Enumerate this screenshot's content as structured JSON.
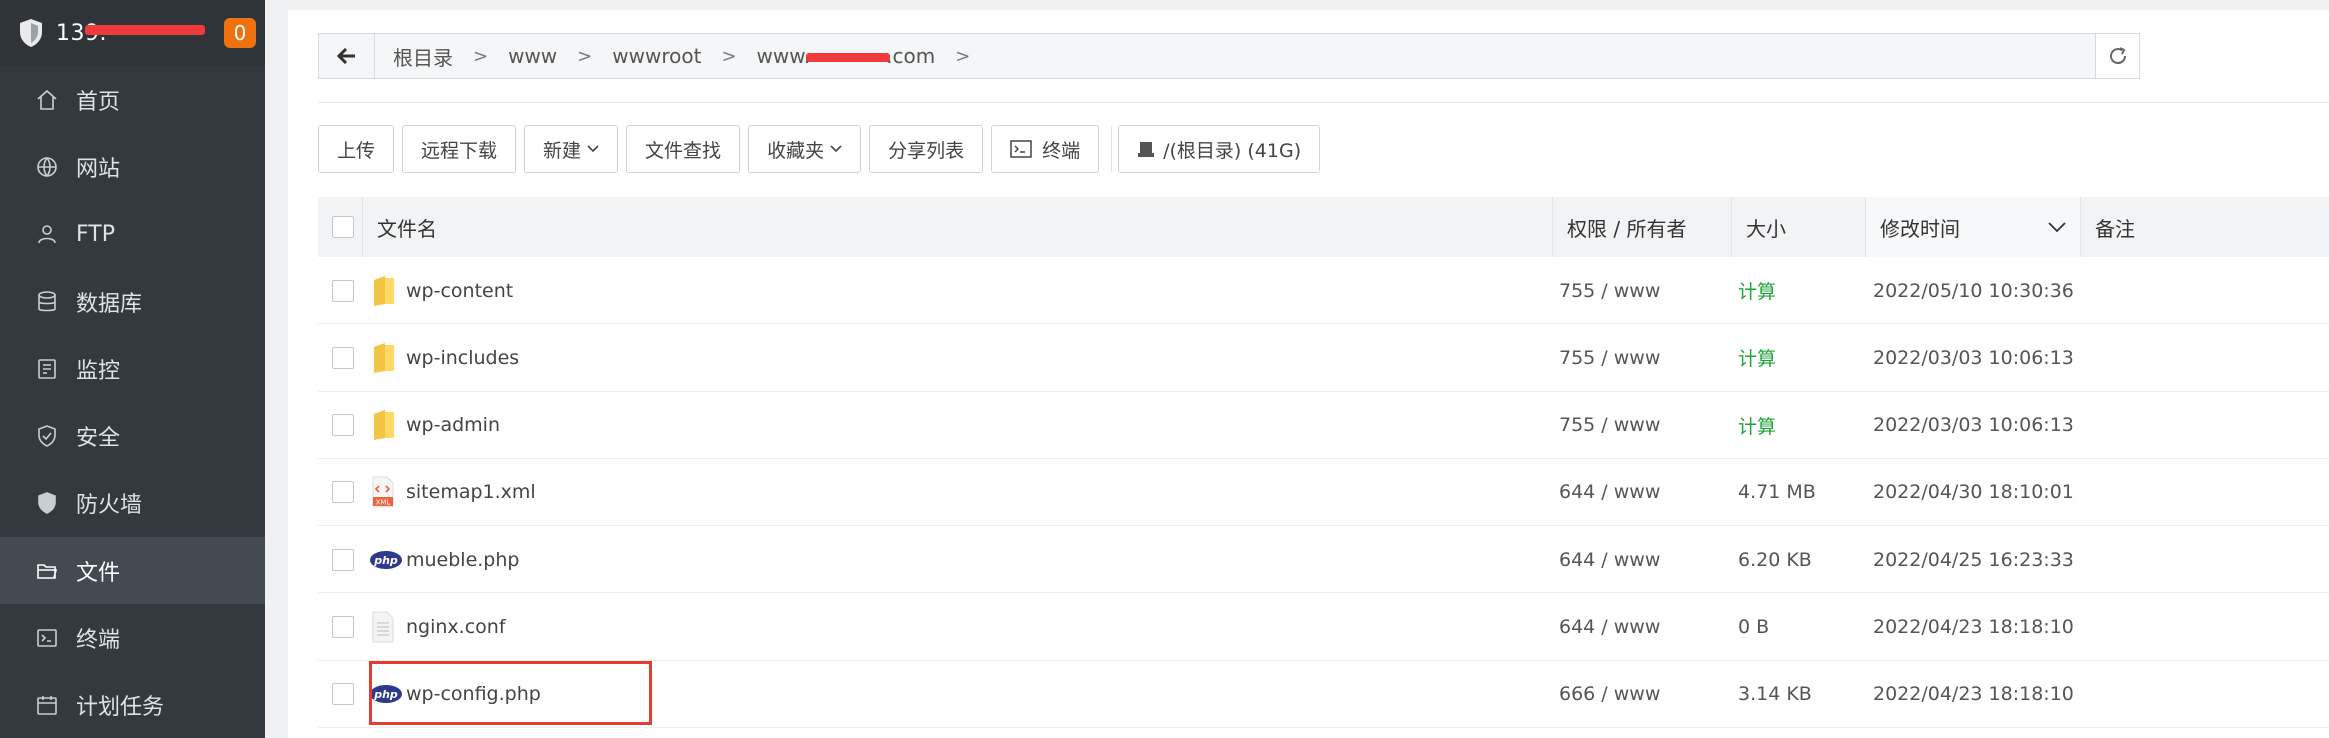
{
  "sidebar": {
    "server_ip": "139.",
    "badge": "0",
    "items": [
      {
        "label": "首页",
        "icon": "home-icon"
      },
      {
        "label": "网站",
        "icon": "globe-icon"
      },
      {
        "label": "FTP",
        "icon": "ftp-icon"
      },
      {
        "label": "数据库",
        "icon": "database-icon"
      },
      {
        "label": "监控",
        "icon": "monitor-icon"
      },
      {
        "label": "安全",
        "icon": "shield-check-icon"
      },
      {
        "label": "防火墙",
        "icon": "firewall-icon"
      },
      {
        "label": "文件",
        "icon": "folder-icon",
        "active": true
      },
      {
        "label": "终端",
        "icon": "terminal-icon"
      },
      {
        "label": "计划任务",
        "icon": "calendar-icon"
      }
    ]
  },
  "breadcrumb": {
    "items": [
      "根目录",
      "www",
      "wwwroot",
      "www.",
      ".com"
    ]
  },
  "toolbar": {
    "upload": "上传",
    "remote_download": "远程下载",
    "new": "新建",
    "file_search": "文件查找",
    "favorites": "收藏夹",
    "share_list": "分享列表",
    "terminal": "终端",
    "disk": "/(根目录) (41G)"
  },
  "table": {
    "headers": {
      "name": "文件名",
      "perm": "权限 / 所有者",
      "size": "大小",
      "mtime": "修改时间",
      "note": "备注"
    },
    "rows": [
      {
        "name": "wp-content",
        "type": "folder",
        "perm": "755 / www",
        "size": "计算",
        "mtime": "2022/05/10 10:30:36"
      },
      {
        "name": "wp-includes",
        "type": "folder",
        "perm": "755 / www",
        "size": "计算",
        "mtime": "2022/03/03 10:06:13"
      },
      {
        "name": "wp-admin",
        "type": "folder",
        "perm": "755 / www",
        "size": "计算",
        "mtime": "2022/03/03 10:06:13"
      },
      {
        "name": "sitemap1.xml",
        "type": "xml",
        "perm": "644 / www",
        "size": "4.71 MB",
        "mtime": "2022/04/30 18:10:01"
      },
      {
        "name": "mueble.php",
        "type": "php",
        "perm": "644 / www",
        "size": "6.20 KB",
        "mtime": "2022/04/25 16:23:33"
      },
      {
        "name": "nginx.conf",
        "type": "text",
        "perm": "644 / www",
        "size": "0 B",
        "mtime": "2022/04/23 18:18:10"
      },
      {
        "name": "wp-config.php",
        "type": "php",
        "perm": "666 / www",
        "size": "3.14 KB",
        "mtime": "2022/04/23 18:18:10"
      }
    ]
  },
  "icons": {
    "php_label": "php",
    "xml_label": "XML"
  },
  "colors": {
    "sidebar_bg": "#33393f",
    "accent_green": "#20a53a",
    "badge_orange": "#f0720e",
    "highlight_red": "#e53b35"
  }
}
